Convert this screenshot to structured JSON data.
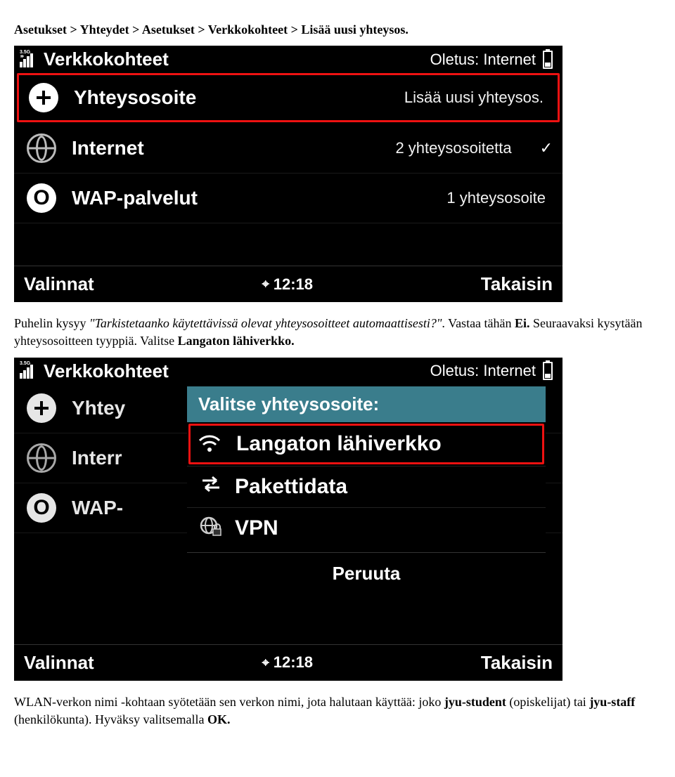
{
  "doc": {
    "breadcrumb_parts": [
      "Asetukset > Yhteydet > Asetukset > Verkkokohteet > ",
      "Lisää uusi yhteysos."
    ],
    "para2_pre": "Puhelin kysyy ",
    "para2_q": "\"Tarkistetaanko käytettävissä olevat yhteysosoitteet automaattisesti?\"",
    "para2_mid": ". Vastaa tähän ",
    "para2_ans": "Ei.",
    "para2_post": " Seuraavaksi kysytään yhteysosoitteen tyyppiä. Valitse ",
    "para2_choice": "Langaton lähiverkko.",
    "para3_pre": "WLAN-verkon nimi -kohtaan syötetään sen verkon nimi, jota halutaan käyttää: joko ",
    "para3_b1": "jyu-student",
    "para3_mid1": " (opiskelijat) tai ",
    "para3_b2": "jyu-staff",
    "para3_mid2": " (henkilökunta). Hyväksy valitsemalla ",
    "para3_b3": "OK."
  },
  "shot1": {
    "title": "Verkkokohteet",
    "oletus": "Oletus: Internet",
    "rows": [
      {
        "label": "Yhteysosoite",
        "value": "Lisää uusi yhteysos."
      },
      {
        "label": "Internet",
        "value": "2 yhteysosoitetta"
      },
      {
        "label": "WAP-palvelut",
        "value": "1 yhteysosoite"
      }
    ],
    "softkeys": {
      "left": "Valinnat",
      "clock": "12:18",
      "right": "Takaisin"
    }
  },
  "shot2": {
    "title": "Verkkokohteet",
    "oletus": "Oletus: Internet",
    "rows_trunc": [
      {
        "label": "Yhtey"
      },
      {
        "label": "Interr"
      },
      {
        "label": "WAP-"
      }
    ],
    "popup": {
      "header": "Valitse yhteysosoite:",
      "items": [
        {
          "label": "Langaton lähiverkko"
        },
        {
          "label": "Pakettidata"
        },
        {
          "label": "VPN"
        }
      ],
      "cancel": "Peruuta"
    },
    "softkeys": {
      "left": "Valinnat",
      "clock": "12:18",
      "right": "Takaisin"
    }
  }
}
